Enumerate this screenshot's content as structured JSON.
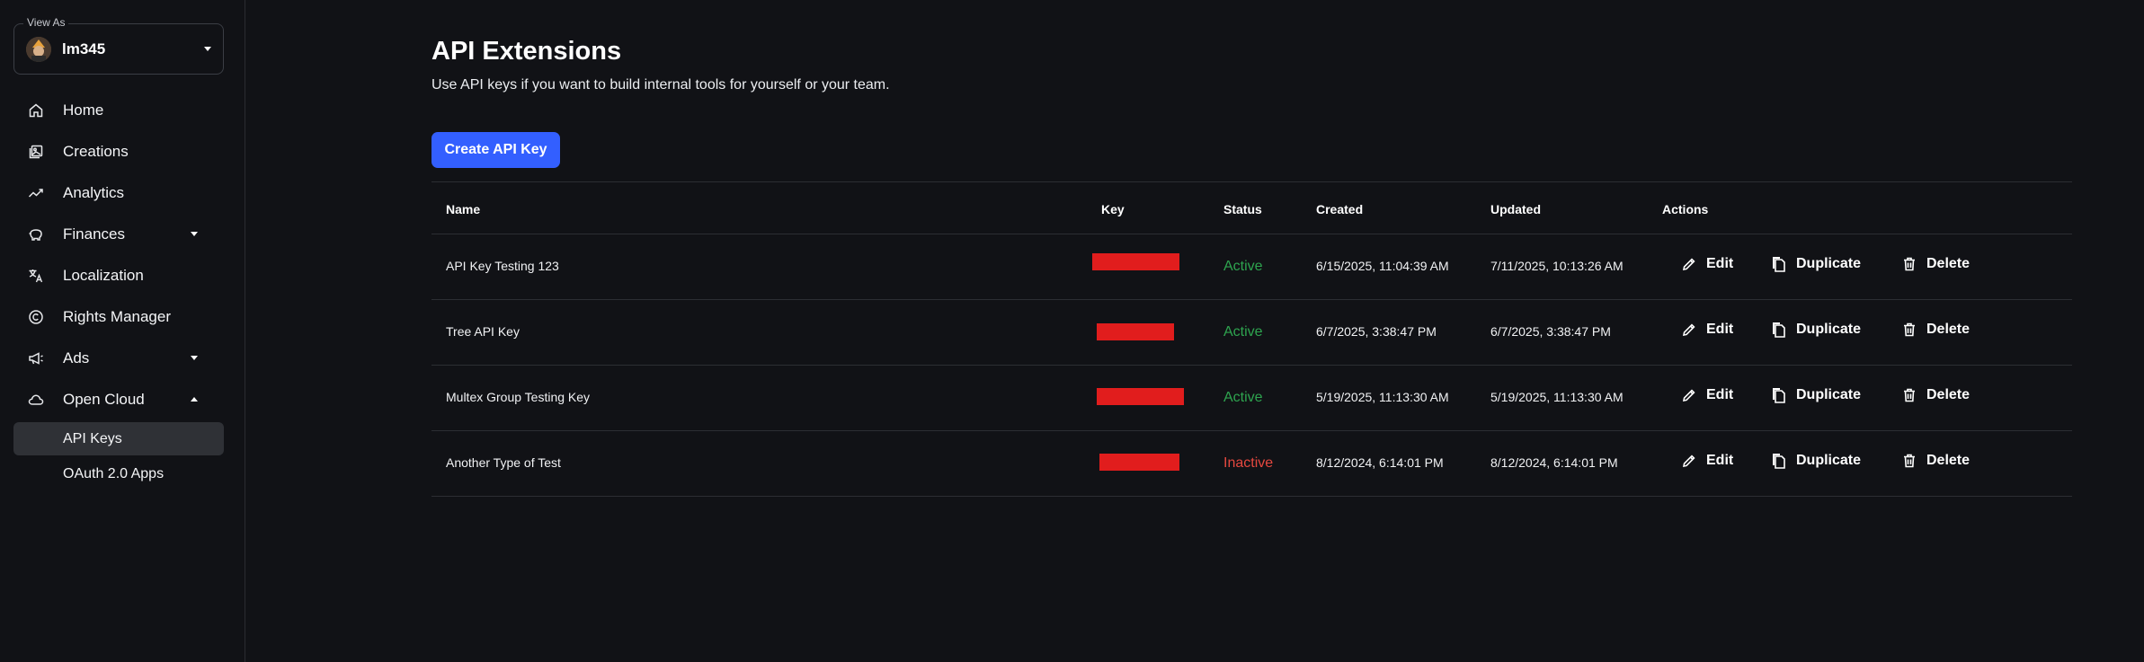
{
  "sidebar": {
    "view_as_label": "View As",
    "user_name": "lm345",
    "items": [
      {
        "label": "Home",
        "icon": "home-icon"
      },
      {
        "label": "Creations",
        "icon": "creations-icon"
      },
      {
        "label": "Analytics",
        "icon": "analytics-icon"
      },
      {
        "label": "Finances",
        "icon": "finances-icon",
        "expandable": true,
        "expanded": false
      },
      {
        "label": "Localization",
        "icon": "translate-icon"
      },
      {
        "label": "Rights Manager",
        "icon": "copyright-icon"
      },
      {
        "label": "Ads",
        "icon": "megaphone-icon",
        "expandable": true,
        "expanded": false
      },
      {
        "label": "Open Cloud",
        "icon": "cloud-icon",
        "expandable": true,
        "expanded": true
      }
    ],
    "sub_items": [
      {
        "label": "API Keys",
        "active": true
      },
      {
        "label": "OAuth 2.0 Apps",
        "active": false
      }
    ]
  },
  "main": {
    "title": "API Extensions",
    "subtitle": "Use API keys if you want to build internal tools for yourself or your team.",
    "create_button": "Create API Key",
    "table": {
      "headers": [
        "Name",
        "Key",
        "Status",
        "Created",
        "Updated",
        "Actions"
      ],
      "rows": [
        {
          "name": "API Key Testing 123",
          "status": "Active",
          "created": "6/15/2025, 11:04:39 AM",
          "updated": "7/11/2025, 10:13:26 AM"
        },
        {
          "name": "Tree API Key",
          "status": "Active",
          "created": "6/7/2025, 3:38:47 PM",
          "updated": "6/7/2025, 3:38:47 PM"
        },
        {
          "name": "Multex Group Testing Key",
          "status": "Active",
          "created": "5/19/2025, 11:13:30 AM",
          "updated": "5/19/2025, 11:13:30 AM"
        },
        {
          "name": "Another Type of Test",
          "status": "Inactive",
          "created": "8/12/2024, 6:14:01 PM",
          "updated": "8/12/2024, 6:14:01 PM"
        }
      ],
      "actions": {
        "edit": "Edit",
        "duplicate": "Duplicate",
        "delete": "Delete"
      }
    }
  },
  "colors": {
    "background": "#111216",
    "accent": "#335fff",
    "active": "#2ea44f",
    "inactive": "#e5483f",
    "redaction": "#e11d1d"
  }
}
